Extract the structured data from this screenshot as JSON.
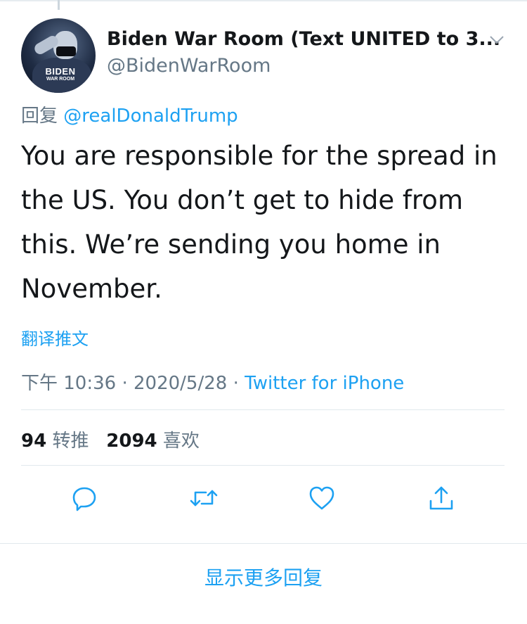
{
  "tweet": {
    "display_name": "Biden War Room (Text UNITED to 3...",
    "handle": "@BidenWarRoom",
    "avatar_logo_main": "BIDEN",
    "avatar_logo_sub": "WAR ROOM",
    "reply_prefix": "回复",
    "reply_to": "@realDonaldTrump",
    "text": "You are responsible for the spread in\nthe US.  You don’t get to hide from\nthis.  We’re sending you home in\nNovember.",
    "translate_label": "翻译推文",
    "time": "下午 10:36",
    "date": "2020/5/28",
    "source": "Twitter for iPhone",
    "separator": "·"
  },
  "stats": {
    "retweets_count": "94",
    "retweets_label": "转推",
    "likes_count": "2094",
    "likes_label": "喜欢"
  },
  "actions": {
    "icons": [
      "reply-icon",
      "retweet-icon",
      "like-icon",
      "share-icon"
    ]
  },
  "footer": {
    "show_more_replies": "显示更多回复"
  },
  "colors": {
    "accent": "#1da1f2",
    "secondary_text": "#657786",
    "primary_text": "#14171a",
    "divider": "#e1e8ed"
  }
}
